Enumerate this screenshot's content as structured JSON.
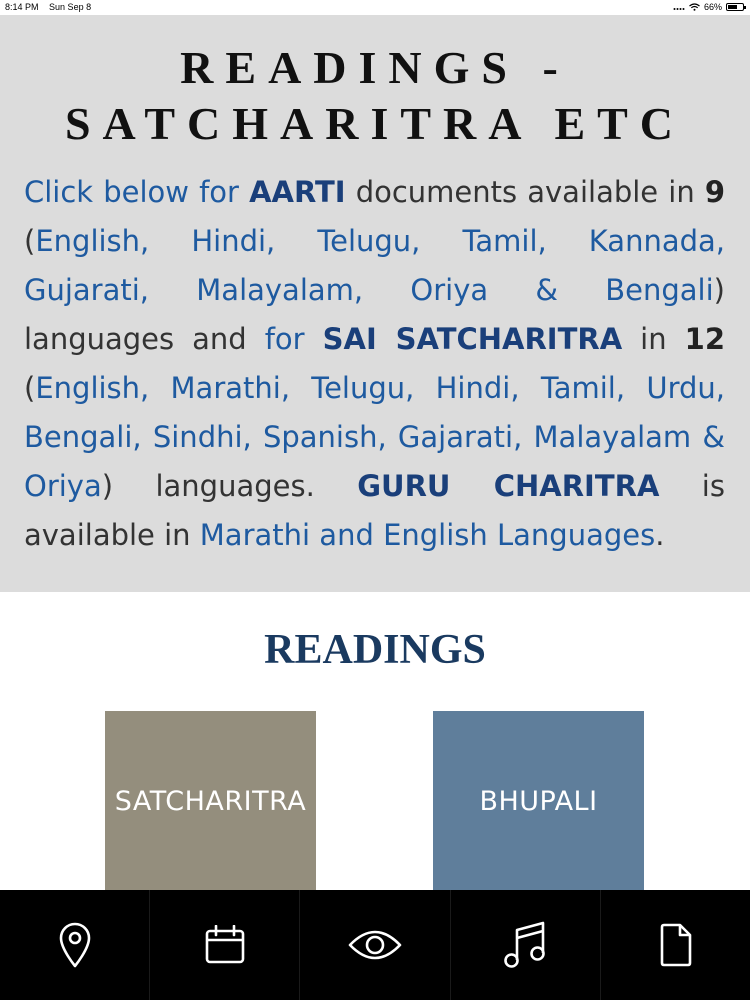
{
  "status_bar": {
    "time": "8:14 PM",
    "date": "Sun Sep 8",
    "battery": "66%",
    "battery_level": 0.66
  },
  "header": {
    "title_line1": "READINGS -",
    "title_line2": "SATCHARITRA ETC"
  },
  "intro": {
    "t1": "Click below for ",
    "aarti": "AARTI",
    "t2": " documents available in ",
    "aarti_count": "9",
    "t3": " (",
    "aarti_languages": "English, Hindi, Telugu, Tamil, Kannada, Gujarati, Malayalam, Oriya & Bengali",
    "t4": ") languages and ",
    "t5": "for ",
    "satcharitra": "SAI SATCHARITRA",
    "t6": " in ",
    "satcharitra_count": "12",
    "t7": " (",
    "satcharitra_languages": "English, Marathi, Telugu, Hindi, Tamil, Urdu, Bengali, Sindhi, Spanish, Gajarati, Malayalam & Oriya",
    "t8": ") languages. ",
    "guru_charitra": "GURU CHARITRA",
    "t9": " is available in ",
    "guru_languages": "Marathi and English Languages",
    "t10": "."
  },
  "readings": {
    "heading": "READINGS",
    "tiles": [
      {
        "label": "SATCHARITRA",
        "color": "#948e7d"
      },
      {
        "label": "BHUPALI",
        "color": "#5f7e9b"
      }
    ]
  },
  "bottom_nav": {
    "items": [
      {
        "icon": "location-pin-icon"
      },
      {
        "icon": "calendar-icon"
      },
      {
        "icon": "eye-icon"
      },
      {
        "icon": "music-note-icon"
      },
      {
        "icon": "document-icon"
      }
    ]
  }
}
